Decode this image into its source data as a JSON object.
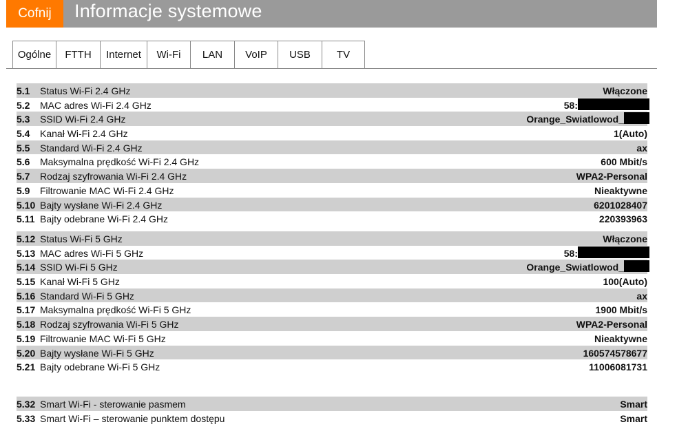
{
  "header": {
    "back_label": "Cofnij",
    "title": "Informacje systemowe"
  },
  "colors": {
    "accent": "#ff7900",
    "header_bg": "#9a9a9a",
    "row_shade": "#cfcfcf"
  },
  "tabs": [
    {
      "label": "Ogólne",
      "active": false
    },
    {
      "label": "FTTH",
      "active": false
    },
    {
      "label": "Internet",
      "active": false
    },
    {
      "label": "Wi-Fi",
      "active": true
    },
    {
      "label": "LAN",
      "active": false
    },
    {
      "label": "VoIP",
      "active": false
    },
    {
      "label": "USB",
      "active": false
    },
    {
      "label": "TV",
      "active": false
    }
  ],
  "sections": [
    {
      "rows": [
        {
          "num": "5.1",
          "label": "Status Wi-Fi 2.4 GHz",
          "value": "Włączone"
        },
        {
          "num": "5.2",
          "label": "MAC adres Wi-Fi 2.4 GHz",
          "value": "58:",
          "redacted": true
        },
        {
          "num": "5.3",
          "label": "SSID Wi-Fi 2.4 GHz",
          "value": "Orange_Swiatlowod_",
          "redacted": true
        },
        {
          "num": "5.4",
          "label": "Kanał Wi-Fi 2.4 GHz",
          "value": "1(Auto)"
        },
        {
          "num": "5.5",
          "label": "Standard Wi-Fi 2.4 GHz",
          "value": "ax"
        },
        {
          "num": "5.6",
          "label": "Maksymalna prędkość Wi-Fi 2.4 GHz",
          "value": "600 Mbit/s"
        },
        {
          "num": "5.7",
          "label": "Rodzaj szyfrowania Wi-Fi 2.4 GHz",
          "value": "WPA2-Personal"
        },
        {
          "num": "5.9",
          "label": "Filtrowanie MAC Wi-Fi 2.4 GHz",
          "value": "Nieaktywne"
        },
        {
          "num": "5.10",
          "label": "Bajty wysłane Wi-Fi 2.4 GHz",
          "value": "6201028407"
        },
        {
          "num": "5.11",
          "label": "Bajty odebrane Wi-Fi 2.4 GHz",
          "value": "220393963"
        }
      ]
    },
    {
      "rows": [
        {
          "num": "5.12",
          "label": "Status Wi-Fi 5 GHz",
          "value": "Włączone"
        },
        {
          "num": "5.13",
          "label": "MAC adres Wi-Fi 5 GHz",
          "value": "58:",
          "redacted": true
        },
        {
          "num": "5.14",
          "label": "SSID Wi-Fi 5 GHz",
          "value": "Orange_Swiatlowod_",
          "redacted": true
        },
        {
          "num": "5.15",
          "label": "Kanał Wi-Fi 5 GHz",
          "value": "100(Auto)"
        },
        {
          "num": "5.16",
          "label": "Standard Wi-Fi 5 GHz",
          "value": "ax"
        },
        {
          "num": "5.17",
          "label": "Maksymalna prędkość Wi-Fi 5 GHz",
          "value": "1900 Mbit/s"
        },
        {
          "num": "5.18",
          "label": "Rodzaj szyfrowania Wi-Fi 5 GHz",
          "value": "WPA2-Personal"
        },
        {
          "num": "5.19",
          "label": "Filtrowanie MAC Wi-Fi 5 GHz",
          "value": "Nieaktywne"
        },
        {
          "num": "5.20",
          "label": "Bajty wysłane Wi-Fi 5 GHz",
          "value": "160574578677"
        },
        {
          "num": "5.21",
          "label": "Bajty odebrane Wi-Fi 5 GHz",
          "value": "11006081731"
        }
      ]
    },
    {
      "rows": [
        {
          "num": "5.32",
          "label": "Smart Wi-Fi - sterowanie pasmem",
          "value": "Smart"
        },
        {
          "num": "5.33",
          "label": "Smart Wi-Fi – sterowanie punktem dostępu",
          "value": "Smart"
        }
      ]
    }
  ]
}
